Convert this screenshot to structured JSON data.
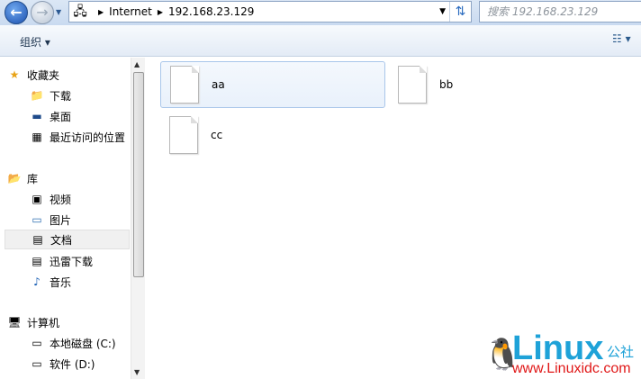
{
  "address": {
    "crumbs": [
      "Internet",
      "192.168.23.129"
    ],
    "search_placeholder": "搜索 192.168.23.129"
  },
  "toolbar": {
    "organize": "组织 ▾"
  },
  "sidebar": {
    "favorites": {
      "label": "收藏夹",
      "items": [
        "下载",
        "桌面",
        "最近访问的位置"
      ]
    },
    "libraries": {
      "label": "库",
      "items": [
        "视频",
        "图片",
        "文档",
        "迅雷下载",
        "音乐"
      ],
      "selected": "文档"
    },
    "computer": {
      "label": "计算机",
      "items": [
        "本地磁盘 (C:)",
        "软件 (D:)"
      ]
    }
  },
  "files": [
    {
      "name": "aa",
      "selected": true
    },
    {
      "name": "bb"
    },
    {
      "name": "cc"
    }
  ],
  "watermark": {
    "brand": "Linux",
    "cn": "公社",
    "url": "www.Linuxidc.com"
  }
}
